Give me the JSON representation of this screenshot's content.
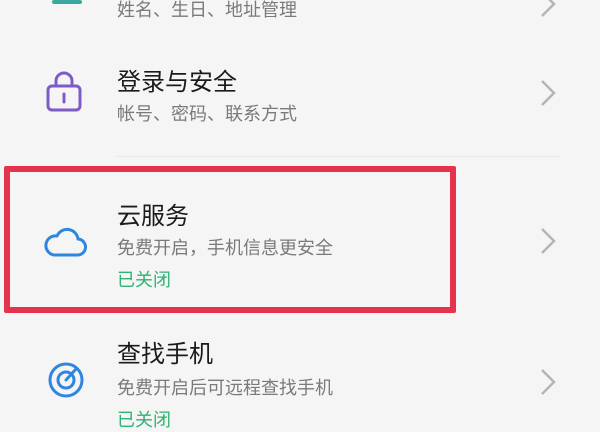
{
  "colors": {
    "background": "#f5f5f5",
    "accent_green": "#2eb372",
    "highlight_red": "#e5334b",
    "icon_purple": "#7b5cc8",
    "icon_blue": "#2f86e0"
  },
  "rows": [
    {
      "subtitle": "姓名、生日、地址管理"
    },
    {
      "title": "登录与安全",
      "subtitle": "帐号、密码、联系方式",
      "icon": "lock-icon"
    },
    {
      "title": "云服务",
      "subtitle": "免费开启，手机信息更安全",
      "status": "已关闭",
      "icon": "cloud-icon",
      "highlighted": true
    },
    {
      "title": "查找手机",
      "subtitle": "免费开启后可远程查找手机",
      "status": "已关闭",
      "icon": "radar-icon"
    }
  ]
}
